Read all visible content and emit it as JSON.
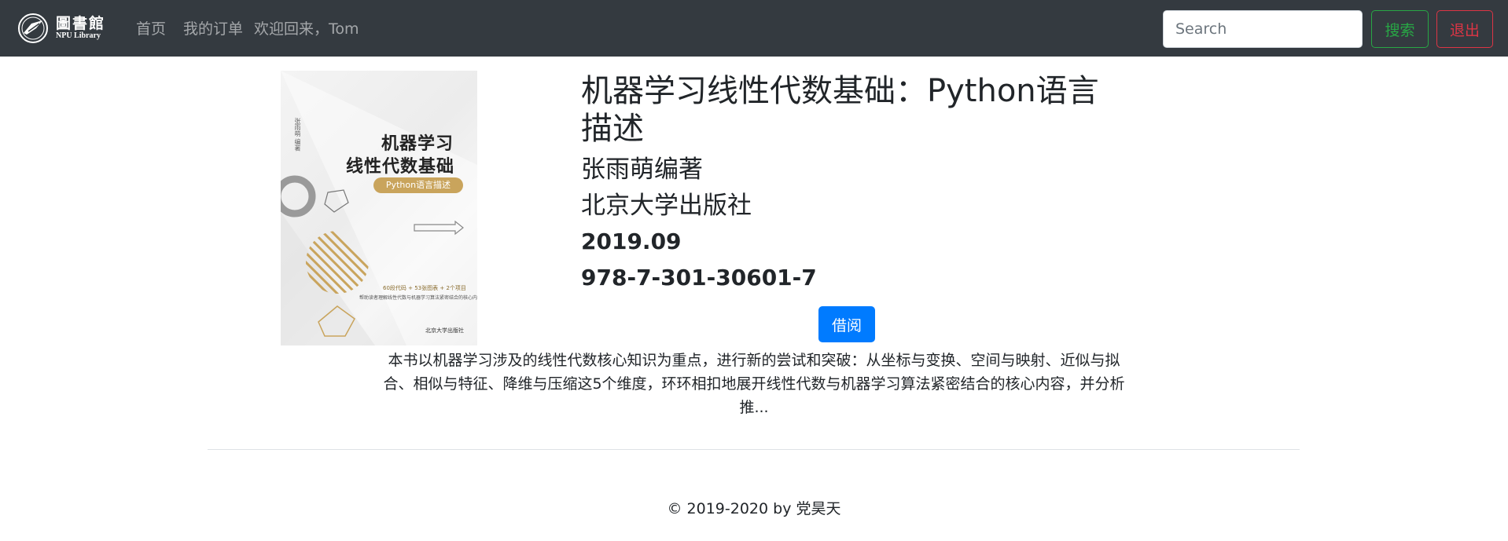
{
  "navbar": {
    "logo_cn": "圖書館",
    "logo_en": "NPU Library",
    "home": "首页",
    "orders": "我的订单",
    "welcome": "欢迎回来，Tom",
    "search_placeholder": "Search",
    "search_button": "搜索",
    "logout_button": "退出"
  },
  "book": {
    "title": "机器学习线性代数基础：Python语言描述",
    "author": "张雨萌编著",
    "publisher": "北京大学出版社",
    "date": "2019.09",
    "isbn": "978-7-301-30601-7",
    "borrow_button": "借阅",
    "description": "本书以机器学习涉及的线性代数核心知识为重点，进行新的尝试和突破：从坐标与变换、空间与映射、近似与拟合、相似与特征、降维与压缩这5个维度，环环相扣地展开线性代数与机器学习算法紧密结合的核心内容，并分析推...",
    "cover": {
      "title_line1": "机器学习",
      "title_line2": "线性代数基础",
      "subtitle": "Python语言描述",
      "author_vertical": "张雨萌 编著",
      "tagline": "60段代码 + 53张图表 + 2个项目",
      "blurb": "帮助读者理解线性代数与机器学习算法紧密结合的核心内容",
      "publisher": "北京大学出版社",
      "accent_color": "#c9a45c"
    }
  },
  "footer": {
    "copyright": "© 2019-2020 by 党昊天"
  },
  "colors": {
    "navbar_bg": "#343a40",
    "primary": "#007bff",
    "success": "#28a745",
    "danger": "#dc3545"
  }
}
